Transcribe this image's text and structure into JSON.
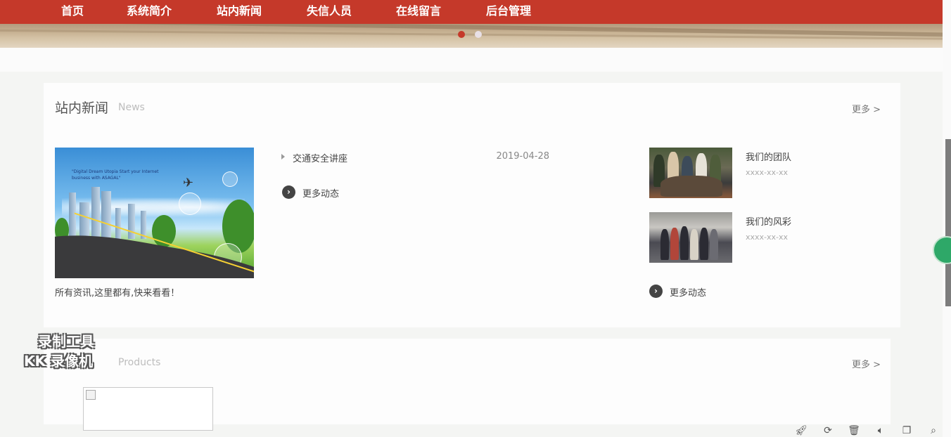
{
  "nav": {
    "items": [
      "首页",
      "系统简介",
      "站内新闻",
      "失信人员",
      "在线留言",
      "后台管理"
    ]
  },
  "news": {
    "title": "站内新闻",
    "subtitle": "News",
    "more": "更多 >",
    "caption": "所有资讯,这里都有,快来看看！",
    "feature_slogan": "\"Digital Dream Utopia Start your Internet business with ASAGAL\"",
    "list": [
      {
        "title": "交通安全讲座",
        "date": "2019-04-28"
      }
    ],
    "more_dynamic": "更多动态",
    "photos": [
      {
        "title": "我们的团队",
        "date": "xxxx-xx-xx"
      },
      {
        "title": "我们的风彩",
        "date": "xxxx-xx-xx"
      }
    ],
    "photos_more": "更多动态"
  },
  "products": {
    "subtitle": "Products",
    "more": "更多 >"
  },
  "watermark": {
    "line1": "录制工具",
    "line2": "KK 录像机"
  },
  "toolbar": {
    "icons": [
      "rocket-icon",
      "refresh-icon",
      "trash-icon",
      "speaker-icon",
      "window-icon",
      "search-icon"
    ]
  },
  "colors": {
    "nav_bg": "#c5392a",
    "page_bg": "#f4f5f3",
    "active_dot": "#c5392a"
  }
}
